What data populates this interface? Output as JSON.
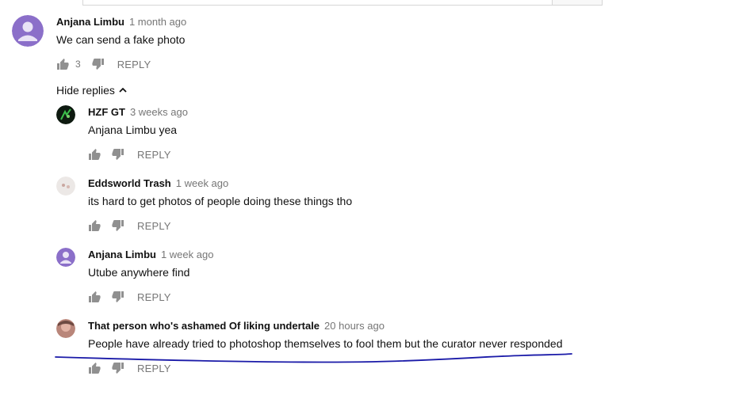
{
  "ui": {
    "reply_label": "REPLY",
    "hide_replies_label": "Hide replies"
  },
  "comments": [
    {
      "author": "Anjana Limbu",
      "time": "1 month ago",
      "text": "We can send a fake photo",
      "likes": "3"
    },
    {
      "author": "HZF GT",
      "time": "3 weeks ago",
      "text": "Anjana Limbu yea"
    },
    {
      "author": "Eddsworld Trash",
      "time": "1 week ago",
      "text": "its hard to get photos of people doing these things tho"
    },
    {
      "author": "Anjana Limbu",
      "time": "1 week ago",
      "text": "Utube anywhere find"
    },
    {
      "author": "That person who's ashamed Of liking undertale",
      "time": "20 hours ago",
      "text": "People have already tried to photoshop themselves to fool them but the curator never responded"
    }
  ],
  "colors": {
    "avatar_purple": "#8b6fc9",
    "annotation_line": "#1a1aa8",
    "icon_gray": "#909090"
  }
}
